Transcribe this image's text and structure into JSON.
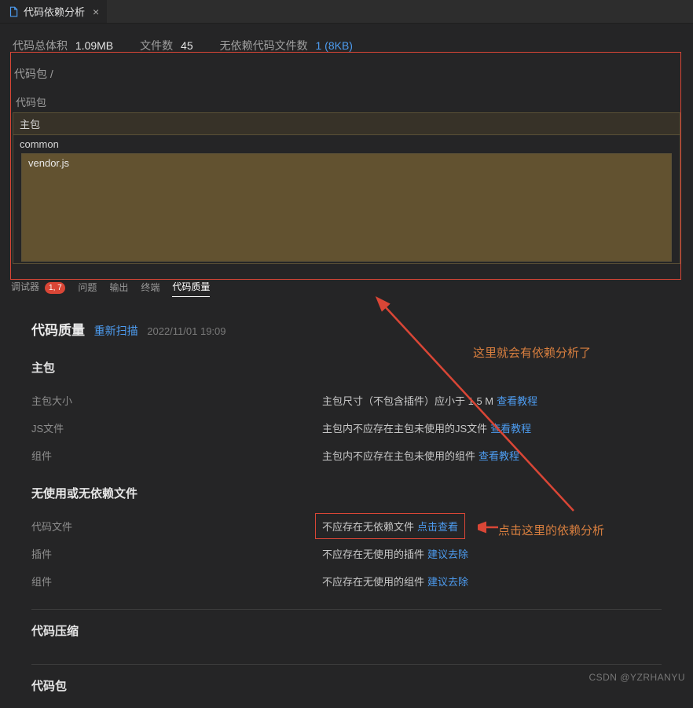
{
  "tab": {
    "title": "代码依赖分析"
  },
  "stats": {
    "size_label": "代码总体积",
    "size_value": "1.09MB",
    "files_label": "文件数",
    "files_value": "45",
    "nodep_label": "无依赖代码文件数",
    "nodep_value": "1 (8KB)"
  },
  "breadcrumb": "代码包 /",
  "pkg": {
    "label": "代码包",
    "main": "主包",
    "common": "common",
    "vendor": "vendor.js"
  },
  "bottom_tabs": {
    "debugger": "调试器",
    "debugger_badge": "1, 7",
    "problems": "问题",
    "output": "输出",
    "terminal": "终端",
    "quality": "代码质量"
  },
  "quality": {
    "title": "代码质量",
    "rescan": "重新扫描",
    "timestamp": "2022/11/01 19:09"
  },
  "sec_main": {
    "title": "主包",
    "rows": [
      {
        "lbl": "主包大小",
        "desc": "主包尺寸（不包含插件）应小于 1.5 M",
        "lnk": "查看教程"
      },
      {
        "lbl": "JS文件",
        "desc": "主包内不应存在主包未使用的JS文件",
        "lnk": "查看教程"
      },
      {
        "lbl": "组件",
        "desc": "主包内不应存在主包未使用的组件",
        "lnk": "查看教程"
      }
    ]
  },
  "sec_nouse": {
    "title": "无使用或无依赖文件",
    "rows": [
      {
        "lbl": "代码文件",
        "desc": "不应存在无依赖文件",
        "lnk": "点击查看",
        "boxed": true
      },
      {
        "lbl": "插件",
        "desc": "不应存在无使用的插件",
        "lnk": "建议去除"
      },
      {
        "lbl": "组件",
        "desc": "不应存在无使用的组件",
        "lnk": "建议去除"
      }
    ]
  },
  "sec_compress": {
    "title": "代码压缩"
  },
  "sec_pkg": {
    "title": "代码包"
  },
  "annotations": {
    "a1": "这里就会有依赖分析了",
    "a2": "点击这里的依赖分析"
  },
  "watermark": "CSDN @YZRHANYU"
}
